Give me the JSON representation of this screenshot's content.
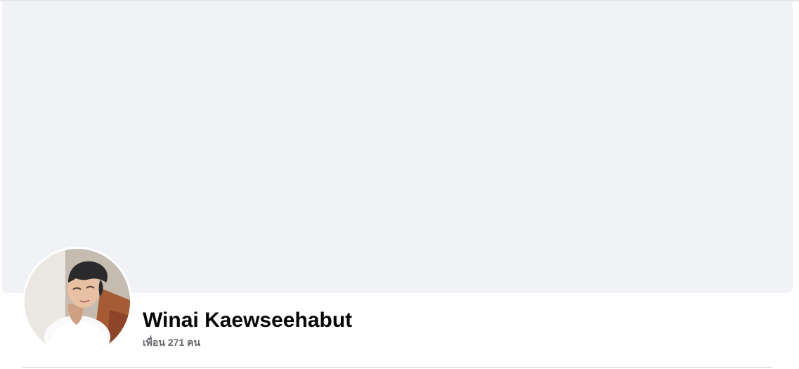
{
  "profile": {
    "name": "Winai Kaewseehabut",
    "friends_text": "เพื่อน 271 คน"
  },
  "colors": {
    "cover_background": "#f0f2f5",
    "name_text": "#050505",
    "secondary_text": "#65676b",
    "divider": "#ced0d4"
  }
}
